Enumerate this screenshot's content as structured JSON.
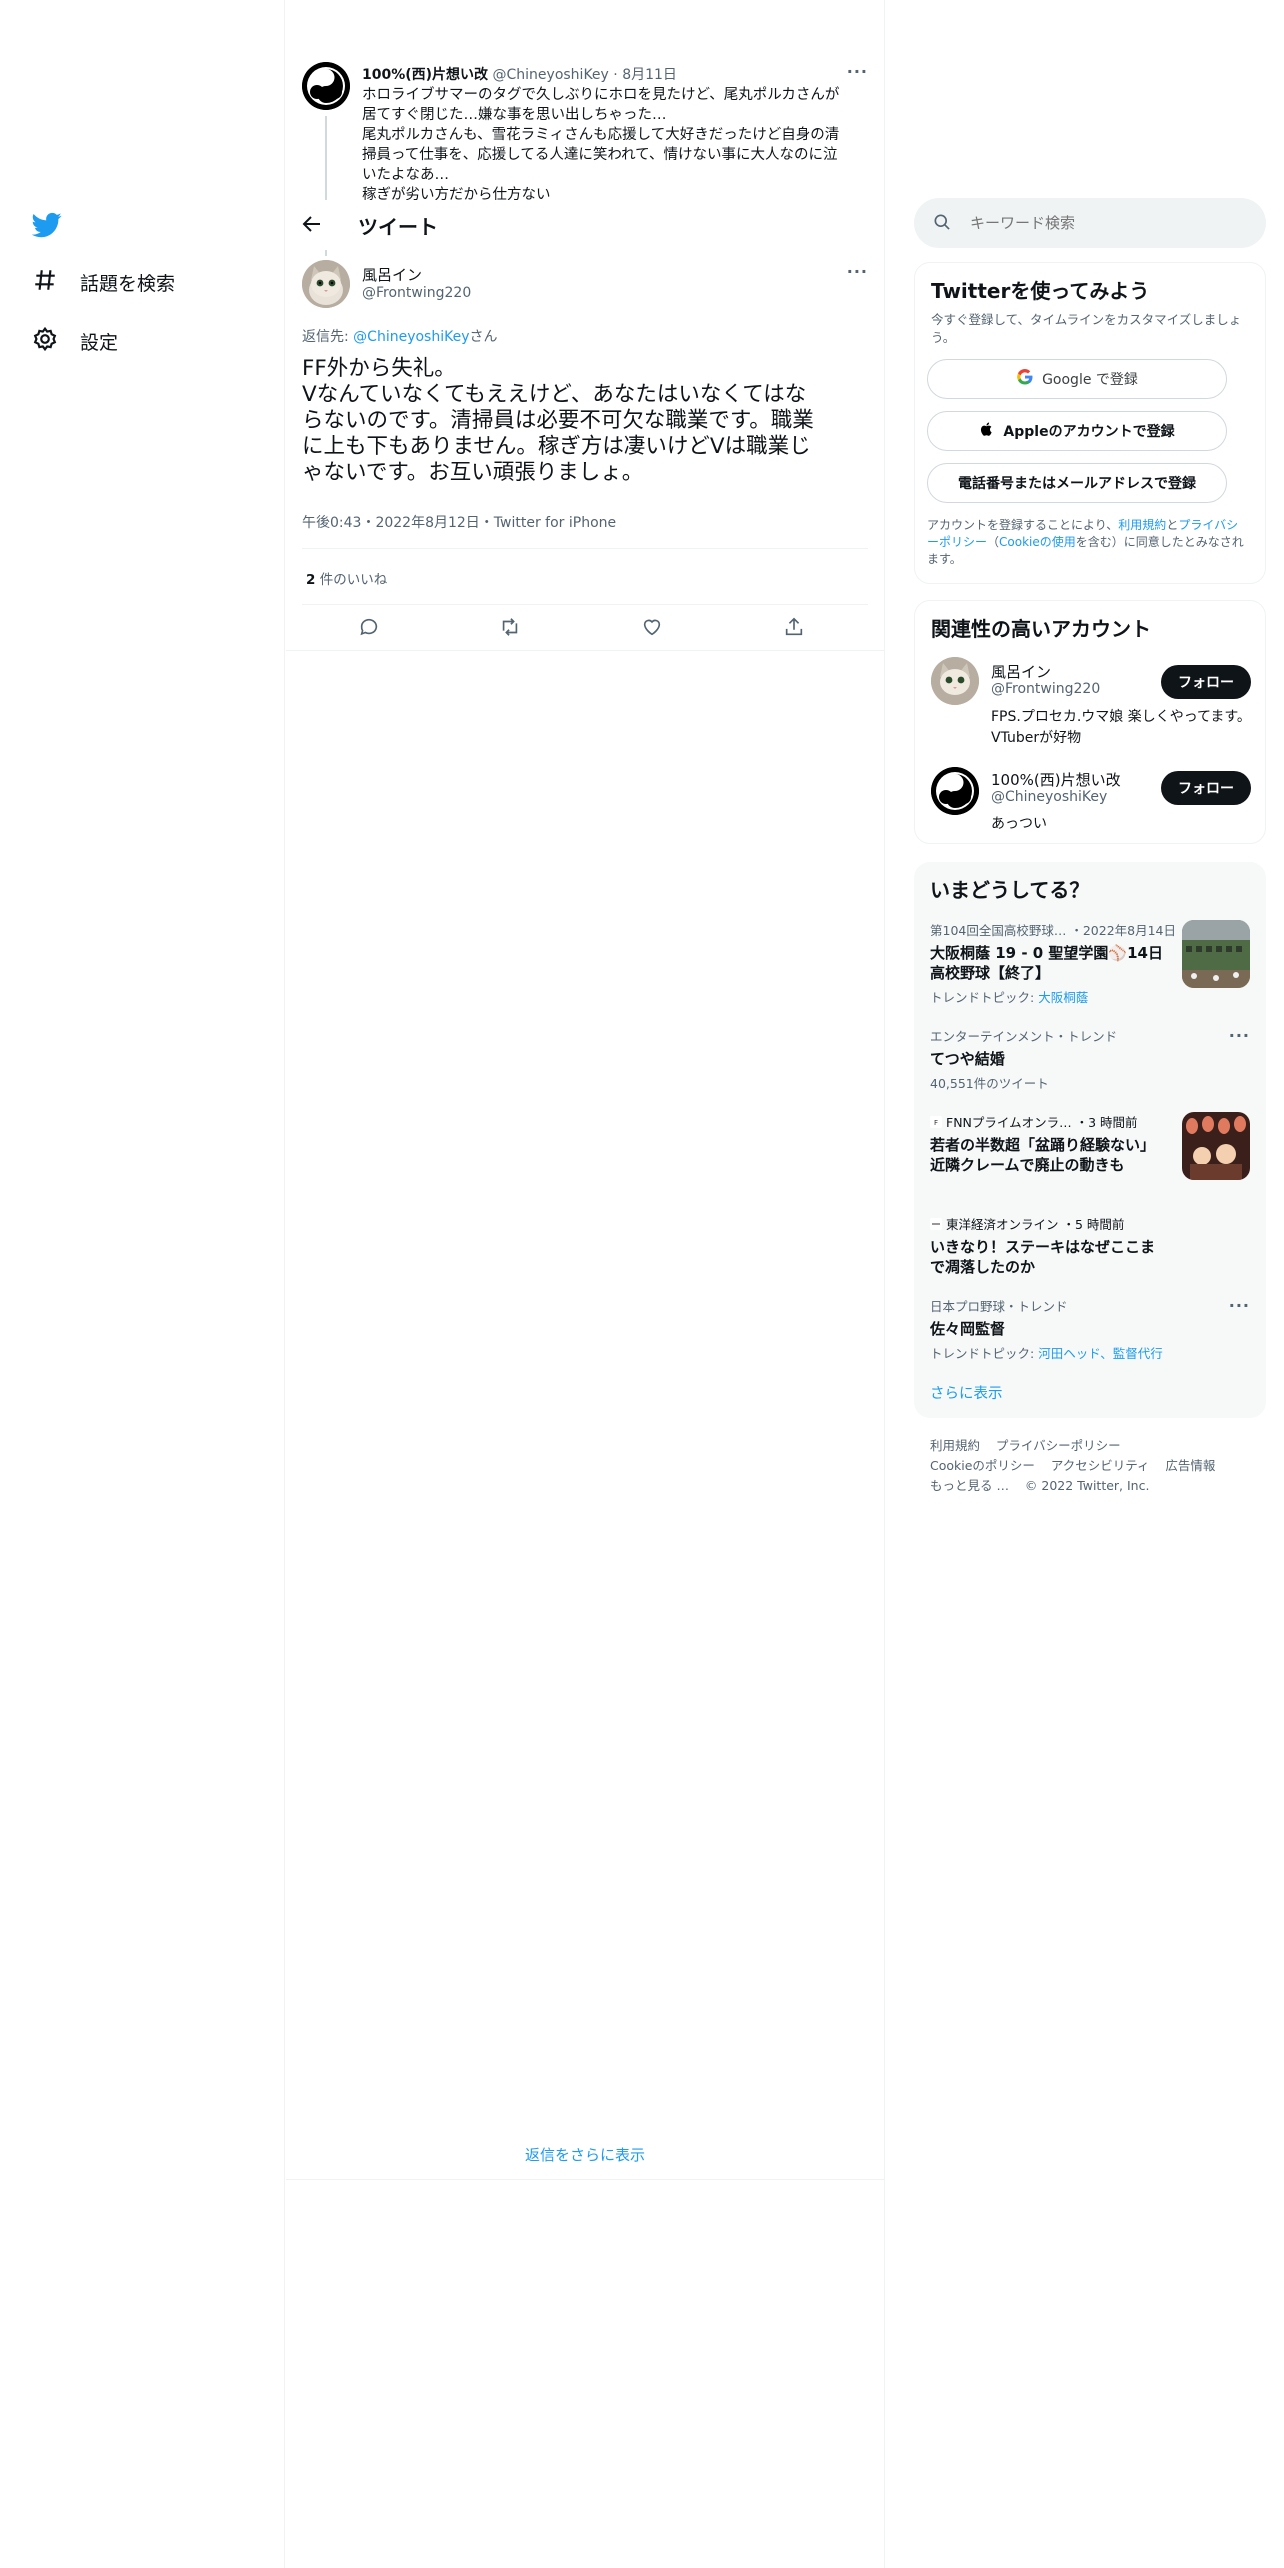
{
  "nav": {
    "explore_label": "話題を検索",
    "settings_label": "設定"
  },
  "parent_tweet": {
    "name": "100%(西)片想い改",
    "handle": "@ChineyoshiKey",
    "date": "8月11日",
    "lines": [
      "ホロライブサマーのタグで久しぶりにホロを見たけど、尾丸ポルカさんが",
      "居てすぐ閉じた…嫌な事を思い出しちゃった…",
      "尾丸ポルカさんも、雪花ラミィさんも応援して大好きだったけど自身の清",
      "掃員って仕事を、応援してる人達に笑われて、情けない事に大人なのに泣",
      "いたよなあ…",
      "稼ぎが劣い方だから仕方ない"
    ]
  },
  "header": {
    "title": "ツイート"
  },
  "main_tweet": {
    "name": "風呂イン",
    "handle": "@Frontwing220",
    "reply_prefix": "返信先: ",
    "reply_to": "@ChineyoshiKey",
    "reply_suffix": "さん",
    "body_lines": [
      "FF外から失礼。",
      "Vなんていなくてもええけど、あなたはいなくてはな",
      "らないのです。清掃員は必要不可欠な職業です。職業",
      "に上も下もありません。稼ぎ方は凄いけどVは職業じ",
      "ゃないです。お互い頑張りましょ。"
    ],
    "timestamp": "午後0:43・2022年8月12日・Twitter for iPhone",
    "likes_count": "2",
    "likes_label": "件のいいね"
  },
  "show_more_replies": "返信をさらに表示",
  "search": {
    "placeholder": "キーワード検索"
  },
  "signup": {
    "title": "Twitterを使ってみよう",
    "desc": "今すぐ登録して、タイムラインをカスタマイズしましょう。",
    "google": "Google で登録",
    "apple": "Appleのアカウントで登録",
    "phone": "電話番号またはメールアドレスで登録",
    "legal_1": "アカウントを登録することにより、",
    "terms": "利用規約",
    "and": "と",
    "privacy": "プライバシーポリシー",
    "cookie_open": "（",
    "cookie": "Cookieの使用",
    "legal_2": "を含む）に同意したとみなされます。"
  },
  "related": {
    "title": "関連性の高いアカウント",
    "accounts": [
      {
        "name": "風呂イン",
        "handle": "@Frontwing220",
        "bio": "FPS.プロセカ.ウマ娘 楽しくやってます。 VTuberが好物",
        "follow": "フォロー"
      },
      {
        "name": "100%(西)片想い改",
        "handle": "@ChineyoshiKey",
        "bio": "あっつい",
        "follow": "フォロー"
      }
    ]
  },
  "trends": {
    "title": "いまどうしてる？",
    "items": [
      {
        "category": "第104回全国高校野球… ・2022年8月14日",
        "title_lines": [
          "大阪桐蔭 19 - 0 聖望学園⚾14日",
          "高校野球【終了】"
        ],
        "sub_label": "トレンドトピック: ",
        "sub_link": "大阪桐蔭"
      },
      {
        "category": "エンターテインメント・トレンド",
        "title_lines": [
          "てつや結婚"
        ],
        "sub_label": "40,551件のツイート",
        "sub_link": ""
      },
      {
        "category": "FNNプライムオンラ… ・3 時間前",
        "title_lines": [
          "若者の半数超「盆踊り経験ない」",
          "近隣クレームで廃止の動きも"
        ],
        "sub_label": "",
        "sub_link": ""
      },
      {
        "category": "東洋経済オンライン ・5 時間前",
        "title_lines": [
          "いきなり！ステーキはなぜここま",
          "で凋落したのか"
        ],
        "sub_label": "",
        "sub_link": ""
      },
      {
        "category": "日本プロ野球・トレンド",
        "title_lines": [
          "佐々岡監督"
        ],
        "sub_label": "トレンドトピック: ",
        "sub_link": "河田ヘッド、監督代行"
      }
    ],
    "show_more": "さらに表示"
  },
  "footer": {
    "line1": [
      "利用規約",
      "プライバシーポリシー"
    ],
    "line2": [
      "Cookieのポリシー",
      "アクセシビリティ",
      "広告情報"
    ],
    "more": "もっと見る …",
    "copyright": "© 2022 Twitter, Inc."
  },
  "colors": {
    "accent": "#1d9bf0",
    "text": "#0f1419",
    "muted": "#536471",
    "border": "#eff3f4"
  }
}
